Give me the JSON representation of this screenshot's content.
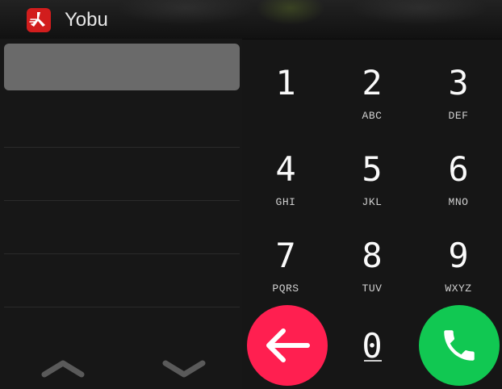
{
  "app": {
    "title": "Yobu",
    "logo_icon": "yobu-logo-icon",
    "brand_color": "#d21d1d"
  },
  "display": {
    "number": ""
  },
  "navigation": {
    "up_icon": "chevron-up-icon",
    "down_icon": "chevron-down-icon"
  },
  "keypad": {
    "keys": [
      {
        "digit": "1",
        "letters": ""
      },
      {
        "digit": "2",
        "letters": "ABC"
      },
      {
        "digit": "3",
        "letters": "DEF"
      },
      {
        "digit": "4",
        "letters": "GHI"
      },
      {
        "digit": "5",
        "letters": "JKL"
      },
      {
        "digit": "6",
        "letters": "MNO"
      },
      {
        "digit": "7",
        "letters": "PQRS"
      },
      {
        "digit": "8",
        "letters": "TUV"
      },
      {
        "digit": "9",
        "letters": "WXYZ"
      },
      {
        "digit": "0",
        "letters": ""
      }
    ],
    "backspace_icon": "arrow-left-icon",
    "backspace_color": "#ff1f50",
    "call_icon": "phone-icon",
    "call_color": "#11c852"
  }
}
